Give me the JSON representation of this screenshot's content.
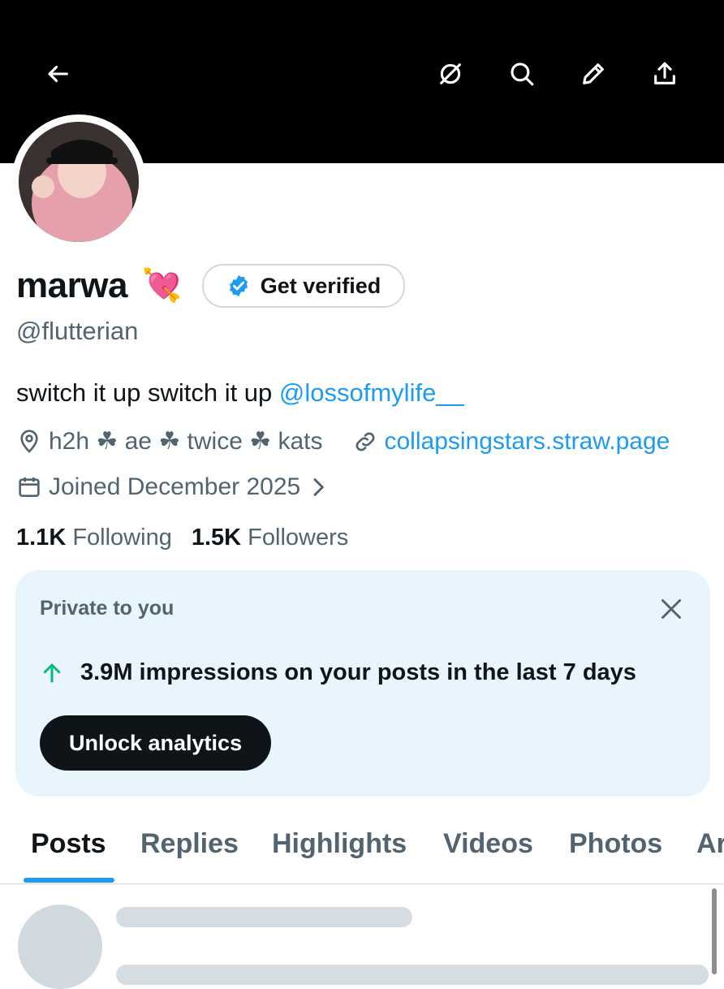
{
  "header": {
    "back_icon": "arrow-left-icon",
    "actions": [
      "hide-icon",
      "search-icon",
      "edit-icon",
      "share-icon"
    ]
  },
  "profile": {
    "name": "marwa",
    "emoji": "💘",
    "get_verified_label": "Get verified",
    "handle": "@flutterian",
    "bio_text": "switch it up switch it up ",
    "bio_mention": "@lossofmylife__",
    "location": "h2h ☘ ae ☘ twice ☘ kats",
    "website": "collapsingstars.straw.page",
    "joined": "Joined December 2025",
    "following_count": "1.1K",
    "following_label": "Following",
    "followers_count": "1.5K",
    "followers_label": "Followers"
  },
  "analytics_card": {
    "label": "Private to you",
    "stat": "3.9M impressions on your posts in the last 7 days",
    "button_label": "Unlock analytics"
  },
  "tabs": [
    "Posts",
    "Replies",
    "Highlights",
    "Videos",
    "Photos",
    "Articles"
  ],
  "colors": {
    "accent": "#1d9bf0",
    "muted_text": "#536471",
    "card_bg": "#e8f5fd",
    "up_arrow": "#00ba7c"
  }
}
